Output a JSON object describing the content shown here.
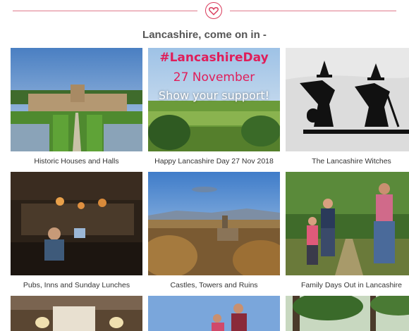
{
  "header": {
    "title": "Lancashire, come on in -"
  },
  "promo": {
    "hashtag": "#LancashireDay",
    "date": "27 November",
    "tagline": "Show your support!"
  },
  "tiles": [
    {
      "caption": "Historic Houses and Halls"
    },
    {
      "caption": "Happy Lancashire Day 27 Nov 2018"
    },
    {
      "caption": "The Lancashire Witches"
    },
    {
      "caption": "Pubs, Inns and Sunday Lunches"
    },
    {
      "caption": "Castles, Towers and Ruins"
    },
    {
      "caption": "Family Days Out in Lancashire"
    }
  ],
  "icons": {
    "divider": "heart-icon"
  },
  "colors": {
    "accent": "#d93a5b",
    "caption_text": "#333333",
    "title_text": "#555555"
  }
}
